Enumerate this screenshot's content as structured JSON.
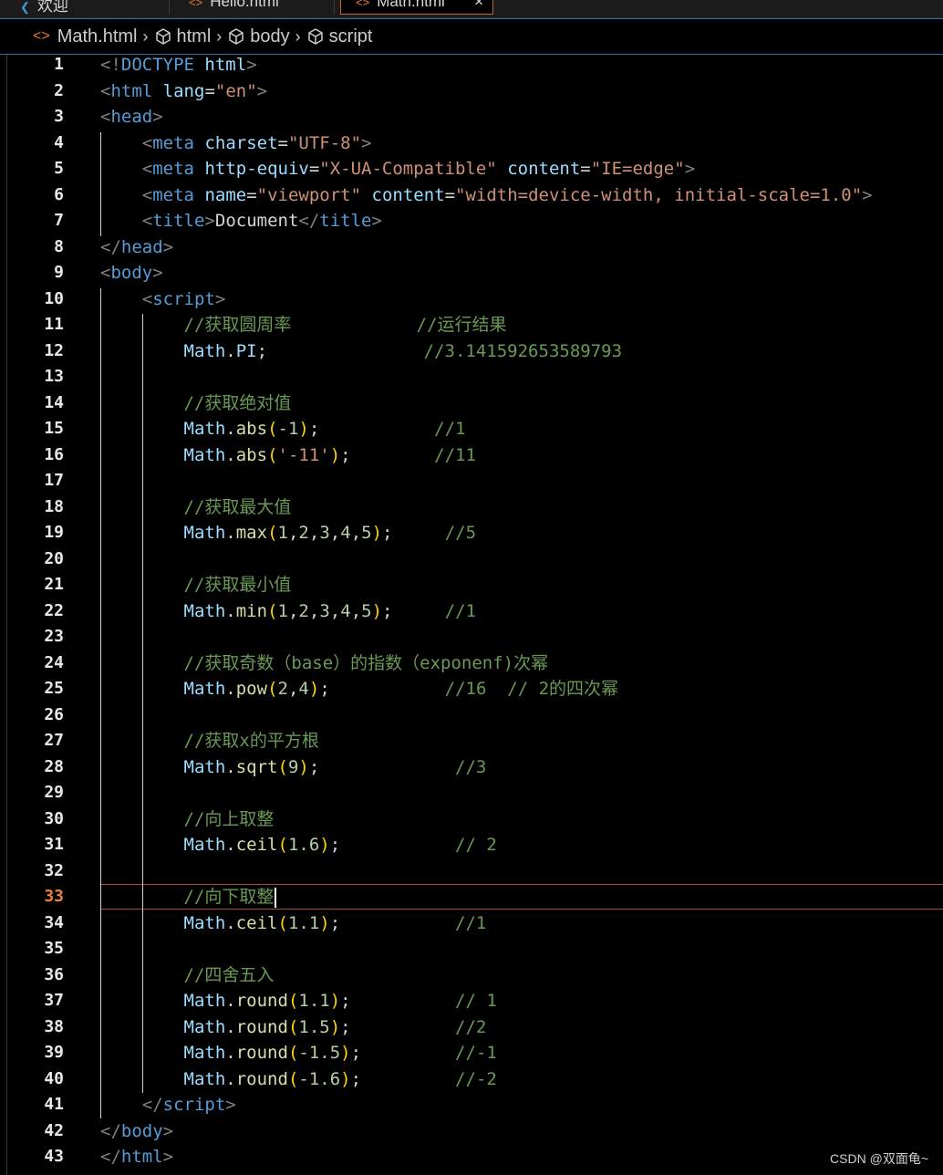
{
  "tabs": [
    {
      "label": "欢迎",
      "icon": "vscode-icon"
    },
    {
      "label": "Hello.html",
      "icon": "html-file-icon"
    },
    {
      "label": "Math.html",
      "icon": "html-file-icon",
      "active": true,
      "close": "×"
    }
  ],
  "breadcrumb": [
    "Math.html",
    "html",
    "body",
    "script"
  ],
  "current_line": 33,
  "lines": [
    {
      "n": 1,
      "tokens": [
        [
          "t",
          "<!"
        ],
        [
          "tag",
          "DOCTYPE"
        ],
        [
          "txt",
          " "
        ],
        [
          "attr",
          "html"
        ],
        [
          "t",
          ">"
        ]
      ]
    },
    {
      "n": 2,
      "tokens": [
        [
          "t",
          "<"
        ],
        [
          "tag",
          "html"
        ],
        [
          "txt",
          " "
        ],
        [
          "attr",
          "lang"
        ],
        [
          "pun",
          "="
        ],
        [
          "str",
          "\"en\""
        ],
        [
          "t",
          ">"
        ]
      ]
    },
    {
      "n": 3,
      "tokens": [
        [
          "t",
          "<"
        ],
        [
          "tag",
          "head"
        ],
        [
          "t",
          ">"
        ]
      ]
    },
    {
      "n": 4,
      "tokens": [
        [
          "txt",
          "    "
        ],
        [
          "t",
          "<"
        ],
        [
          "tag",
          "meta"
        ],
        [
          "txt",
          " "
        ],
        [
          "attr",
          "charset"
        ],
        [
          "pun",
          "="
        ],
        [
          "str",
          "\"UTF-8\""
        ],
        [
          "t",
          ">"
        ]
      ]
    },
    {
      "n": 5,
      "tokens": [
        [
          "txt",
          "    "
        ],
        [
          "t",
          "<"
        ],
        [
          "tag",
          "meta"
        ],
        [
          "txt",
          " "
        ],
        [
          "attr",
          "http-equiv"
        ],
        [
          "pun",
          "="
        ],
        [
          "str",
          "\"X-UA-Compatible\""
        ],
        [
          "txt",
          " "
        ],
        [
          "attr",
          "content"
        ],
        [
          "pun",
          "="
        ],
        [
          "str",
          "\"IE=edge\""
        ],
        [
          "t",
          ">"
        ]
      ]
    },
    {
      "n": 6,
      "tokens": [
        [
          "txt",
          "    "
        ],
        [
          "t",
          "<"
        ],
        [
          "tag",
          "meta"
        ],
        [
          "txt",
          " "
        ],
        [
          "attr",
          "name"
        ],
        [
          "pun",
          "="
        ],
        [
          "str",
          "\"viewport\""
        ],
        [
          "txt",
          " "
        ],
        [
          "attr",
          "content"
        ],
        [
          "pun",
          "="
        ],
        [
          "str",
          "\"width=device-width, initial-scale=1.0\""
        ],
        [
          "t",
          ">"
        ]
      ]
    },
    {
      "n": 7,
      "tokens": [
        [
          "txt",
          "    "
        ],
        [
          "t",
          "<"
        ],
        [
          "tag",
          "title"
        ],
        [
          "t",
          ">"
        ],
        [
          "txt",
          "Document"
        ],
        [
          "t",
          "</"
        ],
        [
          "tag",
          "title"
        ],
        [
          "t",
          ">"
        ]
      ]
    },
    {
      "n": 8,
      "tokens": [
        [
          "t",
          "</"
        ],
        [
          "tag",
          "head"
        ],
        [
          "t",
          ">"
        ]
      ]
    },
    {
      "n": 9,
      "tokens": [
        [
          "t",
          "<"
        ],
        [
          "tag",
          "body"
        ],
        [
          "t",
          ">"
        ]
      ]
    },
    {
      "n": 10,
      "tokens": [
        [
          "txt",
          "    "
        ],
        [
          "t",
          "<"
        ],
        [
          "tag",
          "script"
        ],
        [
          "t",
          ">"
        ]
      ]
    },
    {
      "n": 11,
      "tokens": [
        [
          "txt",
          "        "
        ],
        [
          "cm",
          "//获取圆周率            //运行结果"
        ]
      ]
    },
    {
      "n": 12,
      "tokens": [
        [
          "txt",
          "        "
        ],
        [
          "obj",
          "Math"
        ],
        [
          "pun",
          "."
        ],
        [
          "obj",
          "PI"
        ],
        [
          "pun",
          ";"
        ],
        [
          "txt",
          "               "
        ],
        [
          "cm",
          "//3.141592653589793"
        ]
      ]
    },
    {
      "n": 13,
      "tokens": []
    },
    {
      "n": 14,
      "tokens": [
        [
          "txt",
          "        "
        ],
        [
          "cm",
          "//获取绝对值"
        ]
      ]
    },
    {
      "n": 15,
      "tokens": [
        [
          "txt",
          "        "
        ],
        [
          "obj",
          "Math"
        ],
        [
          "pun",
          "."
        ],
        [
          "fn",
          "abs"
        ],
        [
          "br",
          "("
        ],
        [
          "num",
          "-1"
        ],
        [
          "br",
          ")"
        ],
        [
          "pun",
          ";"
        ],
        [
          "txt",
          "           "
        ],
        [
          "cm",
          "//1"
        ]
      ]
    },
    {
      "n": 16,
      "tokens": [
        [
          "txt",
          "        "
        ],
        [
          "obj",
          "Math"
        ],
        [
          "pun",
          "."
        ],
        [
          "fn",
          "abs"
        ],
        [
          "br",
          "("
        ],
        [
          "str",
          "'-11'"
        ],
        [
          "br",
          ")"
        ],
        [
          "pun",
          ";"
        ],
        [
          "txt",
          "        "
        ],
        [
          "cm",
          "//11"
        ]
      ]
    },
    {
      "n": 17,
      "tokens": []
    },
    {
      "n": 18,
      "tokens": [
        [
          "txt",
          "        "
        ],
        [
          "cm",
          "//获取最大值"
        ]
      ]
    },
    {
      "n": 19,
      "tokens": [
        [
          "txt",
          "        "
        ],
        [
          "obj",
          "Math"
        ],
        [
          "pun",
          "."
        ],
        [
          "fn",
          "max"
        ],
        [
          "br",
          "("
        ],
        [
          "num",
          "1"
        ],
        [
          "pun",
          ","
        ],
        [
          "num",
          "2"
        ],
        [
          "pun",
          ","
        ],
        [
          "num",
          "3"
        ],
        [
          "pun",
          ","
        ],
        [
          "num",
          "4"
        ],
        [
          "pun",
          ","
        ],
        [
          "num",
          "5"
        ],
        [
          "br",
          ")"
        ],
        [
          "pun",
          ";"
        ],
        [
          "txt",
          "     "
        ],
        [
          "cm",
          "//5"
        ]
      ]
    },
    {
      "n": 20,
      "tokens": []
    },
    {
      "n": 21,
      "tokens": [
        [
          "txt",
          "        "
        ],
        [
          "cm",
          "//获取最小值"
        ]
      ]
    },
    {
      "n": 22,
      "tokens": [
        [
          "txt",
          "        "
        ],
        [
          "obj",
          "Math"
        ],
        [
          "pun",
          "."
        ],
        [
          "fn",
          "min"
        ],
        [
          "br",
          "("
        ],
        [
          "num",
          "1"
        ],
        [
          "pun",
          ","
        ],
        [
          "num",
          "2"
        ],
        [
          "pun",
          ","
        ],
        [
          "num",
          "3"
        ],
        [
          "pun",
          ","
        ],
        [
          "num",
          "4"
        ],
        [
          "pun",
          ","
        ],
        [
          "num",
          "5"
        ],
        [
          "br",
          ")"
        ],
        [
          "pun",
          ";"
        ],
        [
          "txt",
          "     "
        ],
        [
          "cm",
          "//1"
        ]
      ]
    },
    {
      "n": 23,
      "tokens": []
    },
    {
      "n": 24,
      "tokens": [
        [
          "txt",
          "        "
        ],
        [
          "cm",
          "//获取奇数（base）的指数（exponenf)次幂"
        ]
      ]
    },
    {
      "n": 25,
      "tokens": [
        [
          "txt",
          "        "
        ],
        [
          "obj",
          "Math"
        ],
        [
          "pun",
          "."
        ],
        [
          "fn",
          "pow"
        ],
        [
          "br",
          "("
        ],
        [
          "num",
          "2"
        ],
        [
          "pun",
          ","
        ],
        [
          "num",
          "4"
        ],
        [
          "br",
          ")"
        ],
        [
          "pun",
          ";"
        ],
        [
          "txt",
          "           "
        ],
        [
          "cm",
          "//16  // 2的四次幂"
        ]
      ]
    },
    {
      "n": 26,
      "tokens": []
    },
    {
      "n": 27,
      "tokens": [
        [
          "txt",
          "        "
        ],
        [
          "cm",
          "//获取x的平方根"
        ]
      ]
    },
    {
      "n": 28,
      "tokens": [
        [
          "txt",
          "        "
        ],
        [
          "obj",
          "Math"
        ],
        [
          "pun",
          "."
        ],
        [
          "fn",
          "sqrt"
        ],
        [
          "br",
          "("
        ],
        [
          "num",
          "9"
        ],
        [
          "br",
          ")"
        ],
        [
          "pun",
          ";"
        ],
        [
          "txt",
          "             "
        ],
        [
          "cm",
          "//3"
        ]
      ]
    },
    {
      "n": 29,
      "tokens": []
    },
    {
      "n": 30,
      "tokens": [
        [
          "txt",
          "        "
        ],
        [
          "cm",
          "//向上取整"
        ]
      ]
    },
    {
      "n": 31,
      "tokens": [
        [
          "txt",
          "        "
        ],
        [
          "obj",
          "Math"
        ],
        [
          "pun",
          "."
        ],
        [
          "fn",
          "ceil"
        ],
        [
          "br",
          "("
        ],
        [
          "num",
          "1.6"
        ],
        [
          "br",
          ")"
        ],
        [
          "pun",
          ";"
        ],
        [
          "txt",
          "           "
        ],
        [
          "cm",
          "// 2"
        ]
      ]
    },
    {
      "n": 32,
      "tokens": []
    },
    {
      "n": 33,
      "tokens": [
        [
          "txt",
          "        "
        ],
        [
          "cm",
          "//向下取整"
        ]
      ],
      "cursor": true
    },
    {
      "n": 34,
      "tokens": [
        [
          "txt",
          "        "
        ],
        [
          "obj",
          "Math"
        ],
        [
          "pun",
          "."
        ],
        [
          "fn",
          "ceil"
        ],
        [
          "br",
          "("
        ],
        [
          "num",
          "1.1"
        ],
        [
          "br",
          ")"
        ],
        [
          "pun",
          ";"
        ],
        [
          "txt",
          "           "
        ],
        [
          "cm",
          "//1"
        ]
      ]
    },
    {
      "n": 35,
      "tokens": []
    },
    {
      "n": 36,
      "tokens": [
        [
          "txt",
          "        "
        ],
        [
          "cm",
          "//四舍五入"
        ]
      ]
    },
    {
      "n": 37,
      "tokens": [
        [
          "txt",
          "        "
        ],
        [
          "obj",
          "Math"
        ],
        [
          "pun",
          "."
        ],
        [
          "fn",
          "round"
        ],
        [
          "br",
          "("
        ],
        [
          "num",
          "1.1"
        ],
        [
          "br",
          ")"
        ],
        [
          "pun",
          ";"
        ],
        [
          "txt",
          "          "
        ],
        [
          "cm",
          "// 1"
        ]
      ]
    },
    {
      "n": 38,
      "tokens": [
        [
          "txt",
          "        "
        ],
        [
          "obj",
          "Math"
        ],
        [
          "pun",
          "."
        ],
        [
          "fn",
          "round"
        ],
        [
          "br",
          "("
        ],
        [
          "num",
          "1.5"
        ],
        [
          "br",
          ")"
        ],
        [
          "pun",
          ";"
        ],
        [
          "txt",
          "          "
        ],
        [
          "cm",
          "//2"
        ]
      ]
    },
    {
      "n": 39,
      "tokens": [
        [
          "txt",
          "        "
        ],
        [
          "obj",
          "Math"
        ],
        [
          "pun",
          "."
        ],
        [
          "fn",
          "round"
        ],
        [
          "br",
          "("
        ],
        [
          "num",
          "-1.5"
        ],
        [
          "br",
          ")"
        ],
        [
          "pun",
          ";"
        ],
        [
          "txt",
          "         "
        ],
        [
          "cm",
          "//-1"
        ]
      ]
    },
    {
      "n": 40,
      "tokens": [
        [
          "txt",
          "        "
        ],
        [
          "obj",
          "Math"
        ],
        [
          "pun",
          "."
        ],
        [
          "fn",
          "round"
        ],
        [
          "br",
          "("
        ],
        [
          "num",
          "-1.6"
        ],
        [
          "br",
          ")"
        ],
        [
          "pun",
          ";"
        ],
        [
          "txt",
          "         "
        ],
        [
          "cm",
          "//-2"
        ]
      ]
    },
    {
      "n": 41,
      "tokens": [
        [
          "txt",
          "    "
        ],
        [
          "t",
          "</"
        ],
        [
          "tag",
          "script"
        ],
        [
          "t",
          ">"
        ]
      ]
    },
    {
      "n": 42,
      "tokens": [
        [
          "t",
          "</"
        ],
        [
          "tag",
          "body"
        ],
        [
          "t",
          ">"
        ]
      ]
    },
    {
      "n": 43,
      "tokens": [
        [
          "t",
          "</"
        ],
        [
          "tag",
          "html"
        ],
        [
          "t",
          ">"
        ]
      ]
    }
  ],
  "watermark": "CSDN @双面龟~"
}
